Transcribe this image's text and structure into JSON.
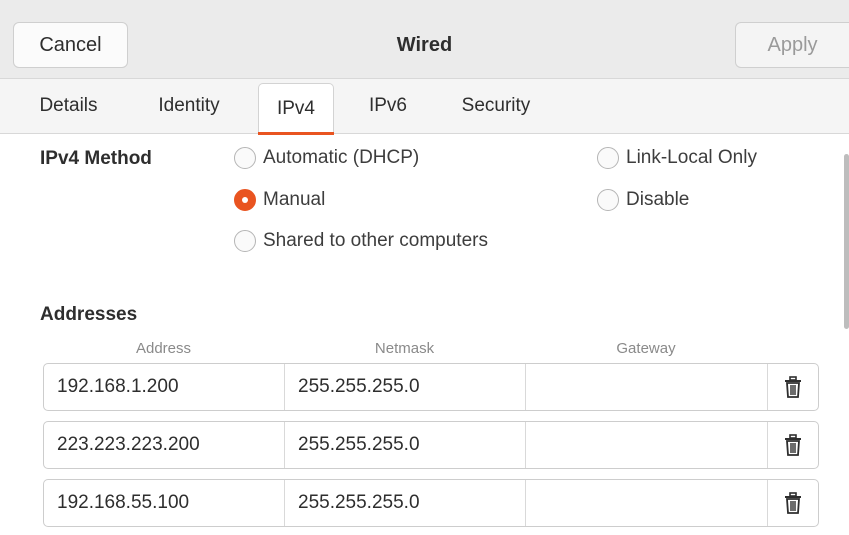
{
  "header": {
    "cancel_label": "Cancel",
    "title": "Wired",
    "apply_label": "Apply"
  },
  "tabs": [
    {
      "label": "Details"
    },
    {
      "label": "Identity"
    },
    {
      "label": "IPv4",
      "active": true
    },
    {
      "label": "IPv6"
    },
    {
      "label": "Security"
    }
  ],
  "ipv4": {
    "method_label": "IPv4 Method",
    "methods": {
      "automatic": "Automatic (DHCP)",
      "manual": "Manual",
      "shared": "Shared to other computers",
      "link_local": "Link-Local Only",
      "disable": "Disable"
    },
    "selected_method": "Manual"
  },
  "addresses": {
    "label": "Addresses",
    "columns": [
      "Address",
      "Netmask",
      "Gateway"
    ],
    "rows": [
      {
        "address": "192.168.1.200",
        "netmask": "255.255.255.0",
        "gateway": ""
      },
      {
        "address": "223.223.223.200",
        "netmask": "255.255.255.0",
        "gateway": ""
      },
      {
        "address": "192.168.55.100",
        "netmask": "255.255.255.0",
        "gateway": ""
      }
    ]
  },
  "icons": {
    "delete": "trash-icon"
  },
  "colors": {
    "accent": "#e95420"
  }
}
